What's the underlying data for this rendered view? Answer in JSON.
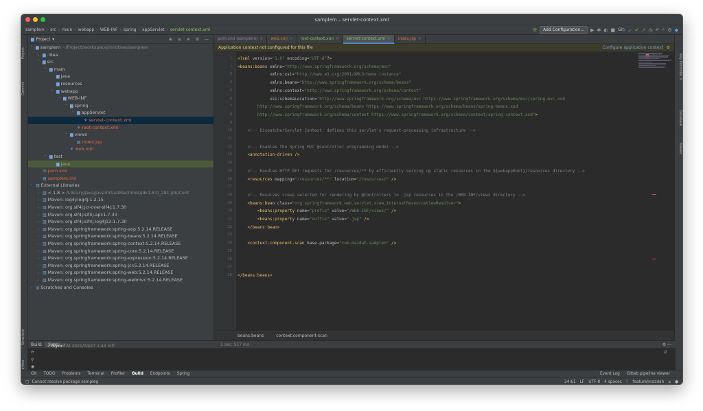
{
  "window_title": "samplem – servlet-context.xml",
  "breadcrumbs": [
    "samplem",
    "src",
    "main",
    "webapp",
    "WEB-INF",
    "spring",
    "appServlet",
    "servlet-context.xml"
  ],
  "toolbar": {
    "add_config": "Add Configuration...",
    "git_label": "Git:"
  },
  "left_tabs": [
    "Project",
    "Commit",
    "Structure",
    "Favorites"
  ],
  "right_tabs": [
    "Key Promoter X",
    "Database",
    "Maven"
  ],
  "project_panel": {
    "title": "Project"
  },
  "tree": [
    {
      "label": "samplem",
      "extra": " ~/Project/workspace/innotree/samplem",
      "depth": 0,
      "arrow": "˅",
      "icon": "▆",
      "cls": ""
    },
    {
      "label": ".idea",
      "depth": 1,
      "arrow": "›",
      "icon": "▆",
      "cls": ""
    },
    {
      "label": "src",
      "depth": 1,
      "arrow": "˅",
      "icon": "▆",
      "cls": ""
    },
    {
      "label": "main",
      "depth": 2,
      "arrow": "˅",
      "icon": "▆",
      "cls": ""
    },
    {
      "label": "java",
      "depth": 3,
      "arrow": "",
      "icon": "▆",
      "cls": ""
    },
    {
      "label": "resources",
      "depth": 3,
      "arrow": "",
      "icon": "▆",
      "cls": ""
    },
    {
      "label": "webapp",
      "depth": 3,
      "arrow": "˅",
      "icon": "▆",
      "cls": ""
    },
    {
      "label": "WEB-INF",
      "depth": 4,
      "arrow": "˅",
      "icon": "▆",
      "cls": ""
    },
    {
      "label": "spring",
      "depth": 5,
      "arrow": "˅",
      "icon": "▆",
      "cls": ""
    },
    {
      "label": "appServlet",
      "depth": 6,
      "arrow": "˅",
      "icon": "▆",
      "cls": ""
    },
    {
      "label": "servlet-context.xml",
      "depth": 7,
      "arrow": "",
      "icon": "⚘",
      "cls": "red sel"
    },
    {
      "label": "root-context.xml",
      "depth": 6,
      "arrow": "",
      "icon": "⚘",
      "cls": "red"
    },
    {
      "label": "views",
      "depth": 5,
      "arrow": "˅",
      "icon": "▆",
      "cls": ""
    },
    {
      "label": "index.jsp",
      "depth": 6,
      "arrow": "",
      "icon": "▤",
      "cls": "red"
    },
    {
      "label": "web.xml",
      "depth": 5,
      "arrow": "",
      "icon": "⚘",
      "cls": "red"
    },
    {
      "label": "test",
      "depth": 2,
      "arrow": "˅",
      "icon": "▆",
      "cls": ""
    },
    {
      "label": "java",
      "depth": 3,
      "arrow": "",
      "icon": "▆",
      "cls": "green sel2"
    },
    {
      "label": "pom.xml",
      "depth": 1,
      "arrow": "",
      "icon": "m",
      "cls": "red"
    },
    {
      "label": "samplem.iml",
      "depth": 1,
      "arrow": "",
      "icon": "▤",
      "cls": "red"
    },
    {
      "label": "External Libraries",
      "depth": 0,
      "arrow": "˅",
      "icon": "▥",
      "cls": ""
    },
    {
      "label": "< 1.8 >",
      "extra": " /Library/Java/JavaVirtualMachines/jdk1.8.0_281.jdk/Cont",
      "depth": 1,
      "arrow": "›",
      "icon": "▥",
      "cls": ""
    },
    {
      "label": "Maven: log4j:log4j:1.2.15",
      "depth": 1,
      "arrow": "›",
      "icon": "▥",
      "cls": ""
    },
    {
      "label": "Maven: org.slf4j:jcl-over-slf4j:1.7.30",
      "depth": 1,
      "arrow": "›",
      "icon": "▥",
      "cls": ""
    },
    {
      "label": "Maven: org.slf4j:slf4j-api:1.7.30",
      "depth": 1,
      "arrow": "›",
      "icon": "▥",
      "cls": ""
    },
    {
      "label": "Maven: org.slf4j:slf4j-log4j12:1.7.30",
      "depth": 1,
      "arrow": "›",
      "icon": "▥",
      "cls": ""
    },
    {
      "label": "Maven: org.springframework:spring-aop:5.2.14.RELEASE",
      "depth": 1,
      "arrow": "›",
      "icon": "▥",
      "cls": ""
    },
    {
      "label": "Maven: org.springframework:spring-beans:5.2.14.RELEASE",
      "depth": 1,
      "arrow": "›",
      "icon": "▥",
      "cls": ""
    },
    {
      "label": "Maven: org.springframework:spring-context:5.2.14.RELEASE",
      "depth": 1,
      "arrow": "›",
      "icon": "▥",
      "cls": ""
    },
    {
      "label": "Maven: org.springframework:spring-core:5.2.14.RELEASE",
      "depth": 1,
      "arrow": "›",
      "icon": "▥",
      "cls": ""
    },
    {
      "label": "Maven: org.springframework:spring-expression:5.2.14.RELEASE",
      "depth": 1,
      "arrow": "›",
      "icon": "▥",
      "cls": ""
    },
    {
      "label": "Maven: org.springframework:spring-jcl:5.2.14.RELEASE",
      "depth": 1,
      "arrow": "›",
      "icon": "▥",
      "cls": ""
    },
    {
      "label": "Maven: org.springframework:spring-web:5.2.14.RELEASE",
      "depth": 1,
      "arrow": "›",
      "icon": "▥",
      "cls": ""
    },
    {
      "label": "Maven: org.springframework:spring-webmvc:5.2.14.RELEASE",
      "depth": 1,
      "arrow": "›",
      "icon": "▥",
      "cls": ""
    },
    {
      "label": "Scratches and Consoles",
      "depth": 0,
      "arrow": "›",
      "icon": "◍",
      "cls": ""
    }
  ],
  "tabs": [
    {
      "label": "pom.xml (samplem)",
      "color": "c-purple",
      "active": false
    },
    {
      "label": "web.xml",
      "color": "c-orange",
      "active": false
    },
    {
      "label": "root-context.xml",
      "color": "c-green",
      "active": false
    },
    {
      "label": "servlet-context.xml",
      "color": "c-green",
      "active": true
    },
    {
      "label": "index.jsp",
      "color": "c-red",
      "active": false
    }
  ],
  "banner": {
    "message": "Application context not configured for this file",
    "action": "Configure application context"
  },
  "problems_count": "3",
  "code_lines": [
    {
      "n": "1",
      "parts": [
        [
          "tag",
          "<?xml "
        ],
        [
          "attr",
          "version="
        ],
        [
          "str",
          "\"1.0\""
        ],
        [
          "attr",
          " encoding="
        ],
        [
          "str",
          "\"UTF-8\""
        ],
        [
          "tag",
          "?>"
        ]
      ]
    },
    {
      "n": "2",
      "parts": [
        [
          "tag",
          "<beans:beans "
        ],
        [
          "attr",
          "xmlns="
        ],
        [
          "str",
          "\"http://www.springframework.org/schema/mvc\""
        ]
      ]
    },
    {
      "n": "3",
      "parts": [
        [
          "attr",
          "             xmlns:xsi="
        ],
        [
          "str",
          "\"http://www.w3.org/2001/XMLSchema-instance\""
        ]
      ]
    },
    {
      "n": "4",
      "parts": [
        [
          "attr",
          "             xmlns:beans="
        ],
        [
          "str",
          "\"http://www.springframework.org/schema/beans\""
        ]
      ]
    },
    {
      "n": "5",
      "parts": [
        [
          "attr",
          "             xmlns:context="
        ],
        [
          "str",
          "\"http://www.springframework.org/schema/context\""
        ]
      ]
    },
    {
      "n": "6",
      "parts": [
        [
          "attr",
          "             xsi:schemaLocation="
        ],
        [
          "str",
          "\"http://www.springframework.org/schema/mvc https://www.springframework.org/schema/mvc/spring-mvc.xsd"
        ]
      ]
    },
    {
      "n": "7",
      "parts": [
        [
          "str",
          "        http://www.springframework.org/schema/beans https://www.springframework.org/schema/beans/spring-beans.xsd"
        ]
      ]
    },
    {
      "n": "8",
      "parts": [
        [
          "str",
          "        http://www.springframework.org/schema/context https://www.springframework.org/schema/context/spring-context.xsd\""
        ],
        [
          "tag",
          ">"
        ]
      ]
    },
    {
      "n": "9",
      "parts": []
    },
    {
      "n": "10",
      "parts": [
        [
          "cmt",
          "    <!-- DispatcherServlet Context: defines this servlet's request-processing infrastructure -->"
        ]
      ]
    },
    {
      "n": "11",
      "parts": []
    },
    {
      "n": "12",
      "parts": [
        [
          "cmt",
          "    <!-- Enables the Spring MVC @Controller programming model -->"
        ]
      ]
    },
    {
      "n": "13",
      "parts": [
        [
          "tag",
          "    <annotation-driven />"
        ]
      ]
    },
    {
      "n": "14",
      "parts": []
    },
    {
      "n": "15",
      "parts": [
        [
          "cmt",
          "    <!-- Handles HTTP GET requests for /resources/** by efficiently serving up static resources in the ${webappRoot}/resources directory -->"
        ]
      ]
    },
    {
      "n": "16",
      "parts": [
        [
          "tag",
          "    <resources "
        ],
        [
          "attr",
          "mapping="
        ],
        [
          "str",
          "\"/resources/**\""
        ],
        [
          "attr",
          " location="
        ],
        [
          "str",
          "\"/resources/\""
        ],
        [
          "tag",
          " />"
        ]
      ]
    },
    {
      "n": "17",
      "parts": []
    },
    {
      "n": "18",
      "parts": [
        [
          "cmt",
          "    <!-- Resolves views selected for rendering by @Controllers to .jsp resources in the /WEB-INF/views directory -->"
        ]
      ]
    },
    {
      "n": "19",
      "parts": [
        [
          "tag",
          "    <beans:bean "
        ],
        [
          "attr",
          "class="
        ],
        [
          "str",
          "\"org.springframework.web.servlet.view.InternalResourceViewResolver\""
        ],
        [
          "tag",
          ">"
        ]
      ]
    },
    {
      "n": "20",
      "parts": [
        [
          "tag",
          "        <beans:property "
        ],
        [
          "attr",
          "name="
        ],
        [
          "str",
          "\"prefix\""
        ],
        [
          "attr",
          " value="
        ],
        [
          "str",
          "\"/WEB-INF/views/\""
        ],
        [
          "tag",
          " />"
        ]
      ]
    },
    {
      "n": "21",
      "parts": [
        [
          "tag",
          "        <beans:property "
        ],
        [
          "attr",
          "name="
        ],
        [
          "str",
          "\"suffix\""
        ],
        [
          "attr",
          " value="
        ],
        [
          "str",
          "\".jsp\""
        ],
        [
          "tag",
          " />"
        ]
      ]
    },
    {
      "n": "22",
      "parts": [
        [
          "tag",
          "    </beans:bean>"
        ]
      ]
    },
    {
      "n": "23",
      "parts": []
    },
    {
      "n": "24",
      "parts": [
        [
          "tag",
          "    <context:component-scan "
        ],
        [
          "attr",
          "base-package="
        ],
        [
          "str",
          "\"com.mazdah.samplem\""
        ],
        [
          "tag",
          " />"
        ]
      ]
    },
    {
      "n": "25",
      "parts": []
    },
    {
      "n": "26",
      "parts": []
    },
    {
      "n": "27",
      "parts": []
    },
    {
      "n": "28",
      "parts": [
        [
          "tag",
          "</beans:beans>"
        ]
      ]
    }
  ],
  "editor_breadcrumb": [
    "beans:beans",
    "context:component-scan"
  ],
  "build": {
    "label": "Build:",
    "tab": "Sync",
    "sync_text": "Sync:",
    "sync_detail": " At 2021/04/27 2:43 오후",
    "duration": "1 sec, 517 ms"
  },
  "bottom_tabs": [
    "Git",
    "TODO",
    "Problems",
    "Terminal",
    "Profiler",
    "Build",
    "Endpoints",
    "Spring"
  ],
  "bottom_right": [
    "Event Log",
    "Gitlab pipeline viewer"
  ],
  "status": {
    "message": "Cannot resolve package sampleg",
    "position": "24:61",
    "line_sep": "LF",
    "encoding": "UTF-8",
    "indent": "4 spaces",
    "branch": "feature/mazdah"
  }
}
